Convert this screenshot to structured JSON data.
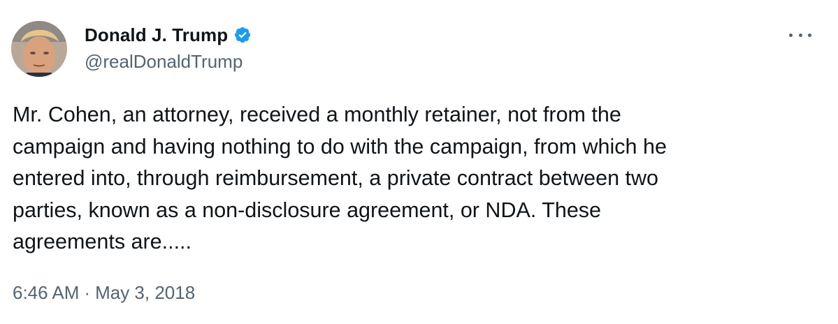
{
  "author": {
    "display_name": "Donald J. Trump",
    "handle": "@realDonaldTrump",
    "verified": true,
    "avatar": "profile-photo"
  },
  "tweet": {
    "text": "Mr. Cohen, an attorney, received a monthly retainer, not from the\ncampaign and having nothing to do with the campaign, from which he\nentered into, through reimbursement, a private contract between two\nparties, known as a non-disclosure agreement, or NDA. These\nagreements are.....",
    "time": "6:46 AM",
    "separator": "·",
    "date": "May 3, 2018"
  },
  "icons": {
    "more": "more-options-icon",
    "verified": "verified-badge-icon"
  },
  "colors": {
    "text": "#0f1419",
    "secondary": "#536471",
    "verified_blue": "#1d9bf0",
    "background": "#ffffff"
  }
}
